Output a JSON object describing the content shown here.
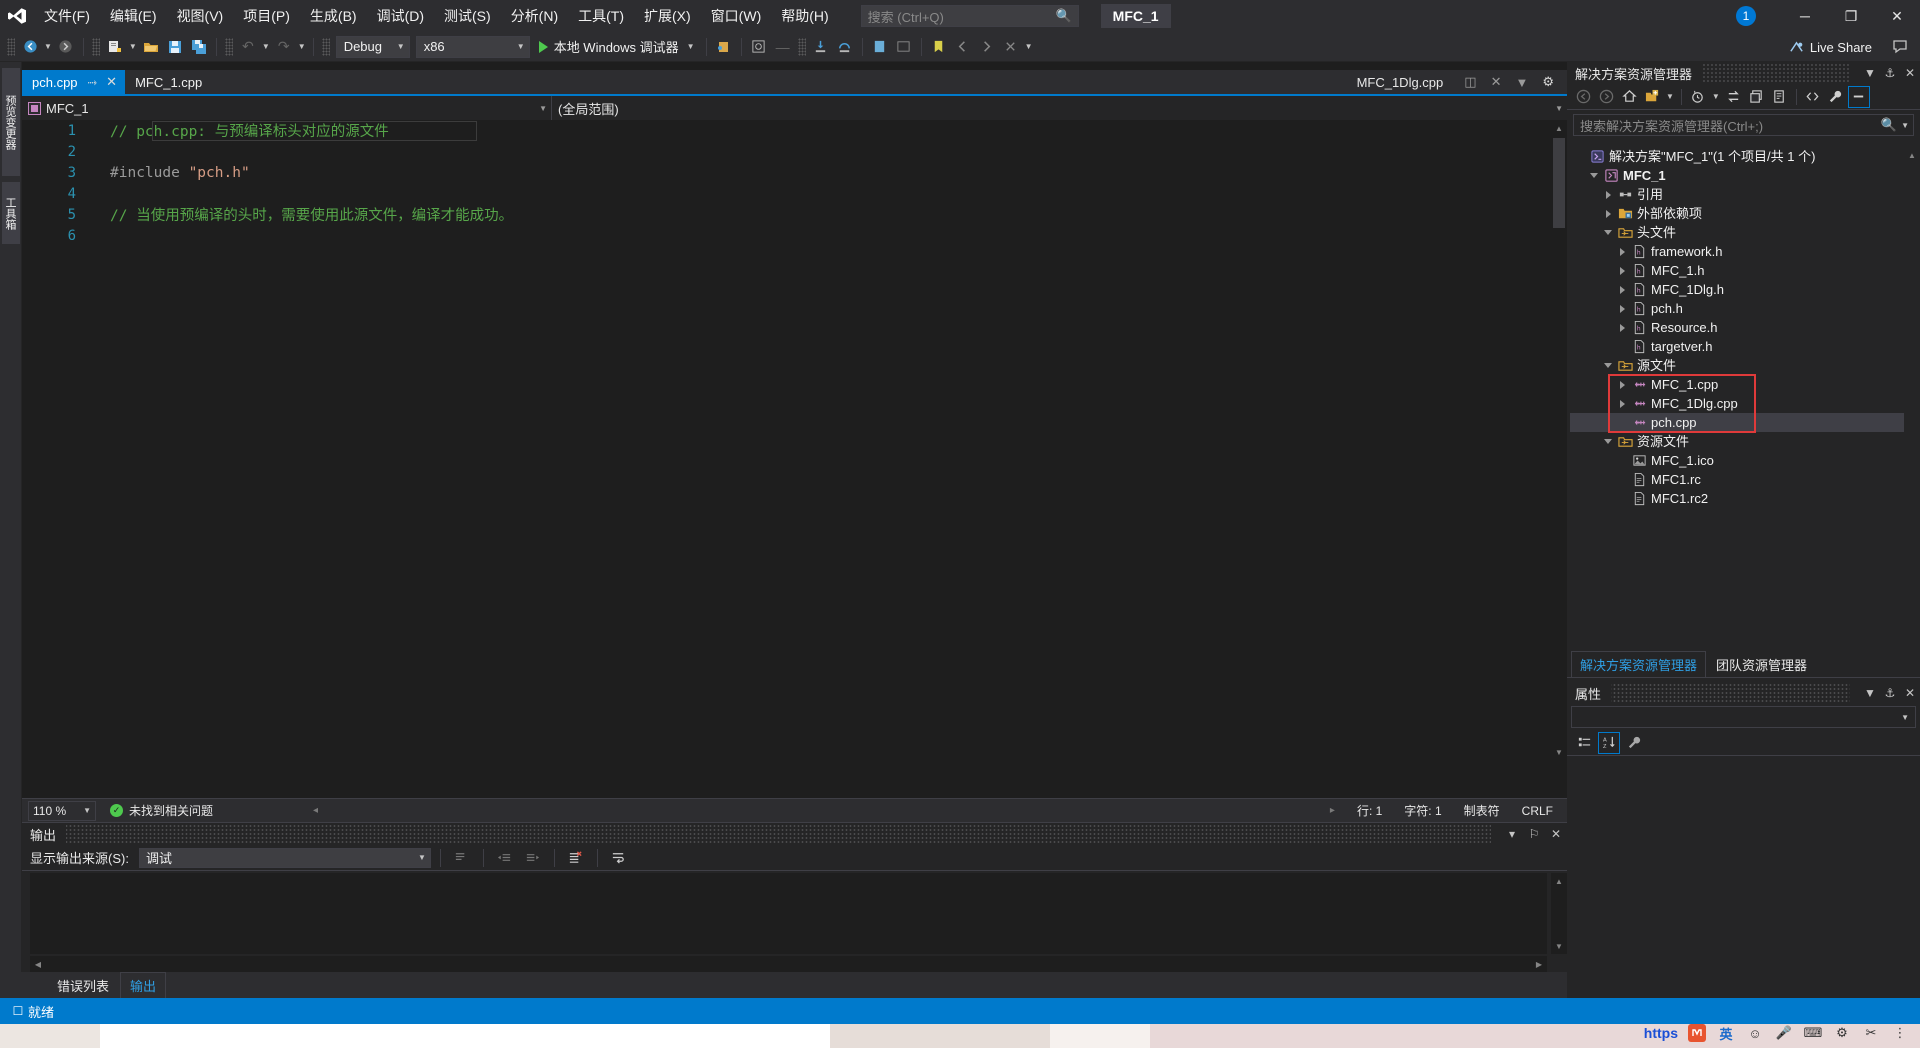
{
  "titlebar": {
    "logo_icon": "visual-studio-logo",
    "menus": [
      {
        "label": "文件(F)"
      },
      {
        "label": "编辑(E)"
      },
      {
        "label": "视图(V)"
      },
      {
        "label": "项目(P)"
      },
      {
        "label": "生成(B)"
      },
      {
        "label": "调试(D)"
      },
      {
        "label": "测试(S)"
      },
      {
        "label": "分析(N)"
      },
      {
        "label": "工具(T)"
      },
      {
        "label": "扩展(X)"
      },
      {
        "label": "窗口(W)"
      },
      {
        "label": "帮助(H)"
      }
    ],
    "search_placeholder": "搜索 (Ctrl+Q)",
    "search_icon": "magnifier-icon",
    "project_chip": "MFC_1",
    "notification_count": "1",
    "minimize": "─",
    "maximize": "❐",
    "close": "✕"
  },
  "toolbar": {
    "nav_back": "←",
    "nav_forward": "→",
    "new_project": "new-project-icon",
    "open_file": "open-folder-icon",
    "save": "save-icon",
    "save_all": "save-all-icon",
    "undo": "↶",
    "redo": "↷",
    "config_value": "Debug",
    "platform_value": "x86",
    "run_label": "本地 Windows 调试器",
    "live_share": "Live Share",
    "accent_color": "#007acc"
  },
  "left_rail": {
    "items": [
      {
        "label": "预览变更器"
      },
      {
        "label": "工具箱"
      }
    ]
  },
  "editor": {
    "tabs": [
      {
        "label": "pch.cpp",
        "active": true,
        "pin": "⤑",
        "close": "✕"
      },
      {
        "label": "MFC_1.cpp",
        "active": false
      }
    ],
    "right_tab_label": "MFC_1Dlg.cpp",
    "nav_left_value": "MFC_1",
    "nav_right_value": "(全局范围)",
    "code_lines": [
      {
        "n": "1",
        "segments": [
          {
            "cls": "c-comment",
            "text": "// pch.cpp: 与预编译标头对应的源文件"
          }
        ]
      },
      {
        "n": "2",
        "segments": []
      },
      {
        "n": "3",
        "segments": [
          {
            "cls": "c-pp",
            "text": "#include "
          },
          {
            "cls": "c-str",
            "text": "\"pch.h\""
          }
        ]
      },
      {
        "n": "4",
        "segments": []
      },
      {
        "n": "5",
        "segments": [
          {
            "cls": "c-comment",
            "text": "// 当使用预编译的头时，需要使用此源文件，编译才能成功。"
          }
        ]
      },
      {
        "n": "6",
        "segments": []
      }
    ],
    "status": {
      "zoom": "110 %",
      "issues": "未找到相关问题",
      "issues_icon": "check-circle-icon",
      "line": "行: 1",
      "col": "字符: 1",
      "tabs_mode": "制表符",
      "line_ending": "CRLF"
    }
  },
  "output": {
    "title": "输出",
    "source_label": "显示输出来源(S):",
    "source_value": "调试",
    "body_text": "",
    "icons": [
      "find-message-icon",
      "go-to-previous-icon",
      "go-to-next-icon",
      "clear-all-icon",
      "toggle-wordwrap-icon"
    ],
    "collapse_icon": "▾",
    "pin_icon": "⚐",
    "close_icon": "✕"
  },
  "bottom_tabs": [
    {
      "label": "错误列表",
      "active": false
    },
    {
      "label": "输出",
      "active": true
    }
  ],
  "solution_explorer": {
    "title": "解决方案资源管理器",
    "header_icons": [
      "chevron-down-icon",
      "pin-icon",
      "close-icon"
    ],
    "toolbar_icons": [
      "back-icon",
      "forward-icon",
      "home-icon",
      "new-folder-icon",
      "chevron-down-icon",
      "pending-changes-icon",
      "chevron-down-icon",
      "sync-icon",
      "collapse-all-icon",
      "properties-window-icon",
      "show-all-files-icon",
      "wrench-icon",
      "preview-selected-icon"
    ],
    "search_placeholder": "搜索解决方案资源管理器(Ctrl+;)",
    "search_icon": "magnifier-icon",
    "tree": [
      {
        "indent": 0,
        "arrow": "none",
        "icon": "solution-icon",
        "label": "解决方案\"MFC_1\"(1 个项目/共 1 个)",
        "bold": false,
        "selected": false
      },
      {
        "indent": 1,
        "arrow": "open",
        "icon": "project-icon",
        "label": "MFC_1",
        "bold": true,
        "selected": false
      },
      {
        "indent": 2,
        "arrow": "closed",
        "icon": "references-icon",
        "label": "引用",
        "bold": false,
        "selected": false
      },
      {
        "indent": 2,
        "arrow": "closed",
        "icon": "ext-deps-icon",
        "label": "外部依赖项",
        "bold": false,
        "selected": false
      },
      {
        "indent": 2,
        "arrow": "open",
        "icon": "filter-icon",
        "label": "头文件",
        "bold": false,
        "selected": false
      },
      {
        "indent": 3,
        "arrow": "closed",
        "icon": "h-file-icon",
        "label": "framework.h",
        "bold": false,
        "selected": false
      },
      {
        "indent": 3,
        "arrow": "closed",
        "icon": "h-file-icon",
        "label": "MFC_1.h",
        "bold": false,
        "selected": false
      },
      {
        "indent": 3,
        "arrow": "closed",
        "icon": "h-file-icon",
        "label": "MFC_1Dlg.h",
        "bold": false,
        "selected": false
      },
      {
        "indent": 3,
        "arrow": "closed",
        "icon": "h-file-icon",
        "label": "pch.h",
        "bold": false,
        "selected": false
      },
      {
        "indent": 3,
        "arrow": "closed",
        "icon": "h-file-icon",
        "label": "Resource.h",
        "bold": false,
        "selected": false
      },
      {
        "indent": 3,
        "arrow": "none",
        "icon": "h-file-icon",
        "label": "targetver.h",
        "bold": false,
        "selected": false
      },
      {
        "indent": 2,
        "arrow": "open",
        "icon": "filter-icon",
        "label": "源文件",
        "bold": false,
        "selected": false
      },
      {
        "indent": 3,
        "arrow": "closed",
        "icon": "cpp-file-icon",
        "label": "MFC_1.cpp",
        "bold": false,
        "selected": false
      },
      {
        "indent": 3,
        "arrow": "closed",
        "icon": "cpp-file-icon",
        "label": "MFC_1Dlg.cpp",
        "bold": false,
        "selected": false
      },
      {
        "indent": 3,
        "arrow": "none",
        "icon": "cpp-file-icon",
        "label": "pch.cpp",
        "bold": false,
        "selected": true
      },
      {
        "indent": 2,
        "arrow": "open",
        "icon": "filter-icon",
        "label": "资源文件",
        "bold": false,
        "selected": false
      },
      {
        "indent": 3,
        "arrow": "none",
        "icon": "image-file-icon",
        "label": "MFC_1.ico",
        "bold": false,
        "selected": false
      },
      {
        "indent": 3,
        "arrow": "none",
        "icon": "rc-file-icon",
        "label": "MFC1.rc",
        "bold": false,
        "selected": false
      },
      {
        "indent": 3,
        "arrow": "none",
        "icon": "rc-file-icon",
        "label": "MFC1.rc2",
        "bold": false,
        "selected": false
      }
    ],
    "annotation_color": "#e03a3a",
    "tabs": [
      {
        "label": "解决方案资源管理器",
        "active": true
      },
      {
        "label": "团队资源管理器",
        "active": false
      }
    ]
  },
  "properties": {
    "title": "属性",
    "toolbar_icons": [
      "categorized-icon",
      "alphabetical-icon",
      "properties-icon"
    ],
    "dropdown_value": ""
  },
  "statusbar": {
    "icon": "ready-icon",
    "text": "就绪"
  },
  "taskbar": {
    "https_label": "https",
    "ime_icons": [
      "ime-logo-icon",
      "lang-cn-icon",
      "emoji-icon",
      "mic-icon",
      "keyboard-icon",
      "settings-icon",
      "tool-icon",
      "more-icon"
    ],
    "lang_label": "英"
  }
}
